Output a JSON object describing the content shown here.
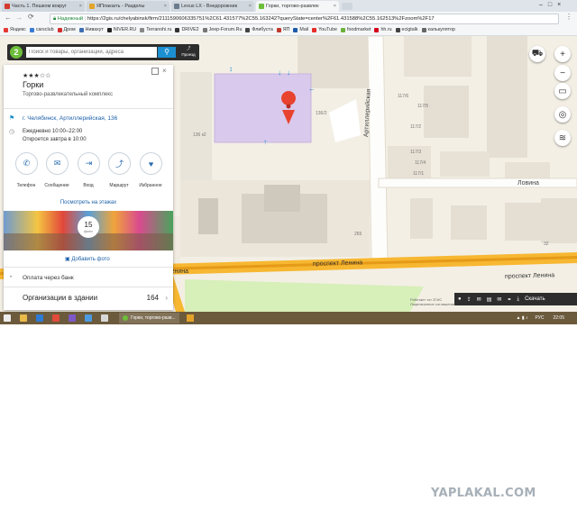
{
  "browser": {
    "tabs": [
      {
        "label": "Часть 1. Пешком вокруг",
        "fav_color": "#d23b2e"
      },
      {
        "label": "ЯПлакалъ - Разделы",
        "fav_color": "#e2a52b"
      },
      {
        "label": "Lexus LX - Внедорожник",
        "fav_color": "#6a7c8e"
      },
      {
        "label": "Горки, торгово-развлек",
        "fav_color": "#6dbf3a"
      }
    ],
    "secure_label": "Надежный",
    "url": "https://2gis.ru/chelyabinsk/firm/2111590606335751%2C61.431577%2C55.163242?queryState=center%2F61.431588%2C55.162513%2Fzoom%2F17",
    "bookmarks": [
      {
        "label": "Яндекс",
        "color": "#e53935"
      },
      {
        "label": "carsclub",
        "color": "#3a7bd5"
      },
      {
        "label": "Дром",
        "color": "#d32f2f"
      },
      {
        "label": "Нивахут",
        "color": "#3f6fb5"
      },
      {
        "label": "NIVER.RU",
        "color": "#222"
      },
      {
        "label": "Terranohi.ru",
        "color": "#888"
      },
      {
        "label": "DRIVE2",
        "color": "#333"
      },
      {
        "label": "Jeep-Forum.Ru",
        "color": "#777"
      },
      {
        "label": "Флибуста",
        "color": "#444"
      },
      {
        "label": "ЯП",
        "color": "#c0392b"
      },
      {
        "label": "Mail",
        "color": "#1e5aa8"
      },
      {
        "label": "YouTube",
        "color": "#e52d27"
      },
      {
        "label": "foodmarket",
        "color": "#6bb13a"
      },
      {
        "label": "hh.ru",
        "color": "#d6001c"
      },
      {
        "label": "ecigtalk",
        "color": "#444"
      },
      {
        "label": "калькулятор",
        "color": "#666"
      }
    ]
  },
  "search": {
    "placeholder": "Поиск и товары, организации, адреса",
    "route_label": "Проезд"
  },
  "place": {
    "name": "Горки",
    "rating_stars": 3,
    "category": "Торгово-развлекательный комплекс",
    "address": "г. Челябинск, Артиллерийская, 136",
    "hours": "Ежедневно 10:00–22:00",
    "opens": "Откроется завтра в 10:00",
    "actions": [
      "Телефон",
      "Сообщение",
      "Вход",
      "Маршрут",
      "Избранное"
    ],
    "inside_link": "Посмотреть на этажах",
    "photos_count": "15",
    "photos_unit": "фото",
    "add_photo": "Добавить фото",
    "payment": "Оплата через банк",
    "orgs_label": "Организации в здании",
    "orgs_count": "164"
  },
  "map": {
    "streets": {
      "artilleriyskaya": "Артиллерийская",
      "lovina": "Ловина",
      "lenina_1": "проспект Ленина",
      "lenina_2": "проспект Ленина",
      "lenina_3": "Ленина"
    },
    "house_numbers": [
      "136/2",
      "136 к2",
      "117/6",
      "117/5",
      "117/2",
      "117/3",
      "117/4",
      "117/1",
      "265",
      "32"
    ],
    "download_label": "Скачать",
    "attribution": "Работает тот 2ГИС\nЛицензионное соглашение",
    "building_color": "#d9c9ec",
    "marker_color": "#e8432e"
  },
  "taskbar": {
    "window_label": "Горки, торгово-разв...",
    "lang": "РУС",
    "time": "22:05"
  },
  "watermark": "YAPLAKAL.COM"
}
